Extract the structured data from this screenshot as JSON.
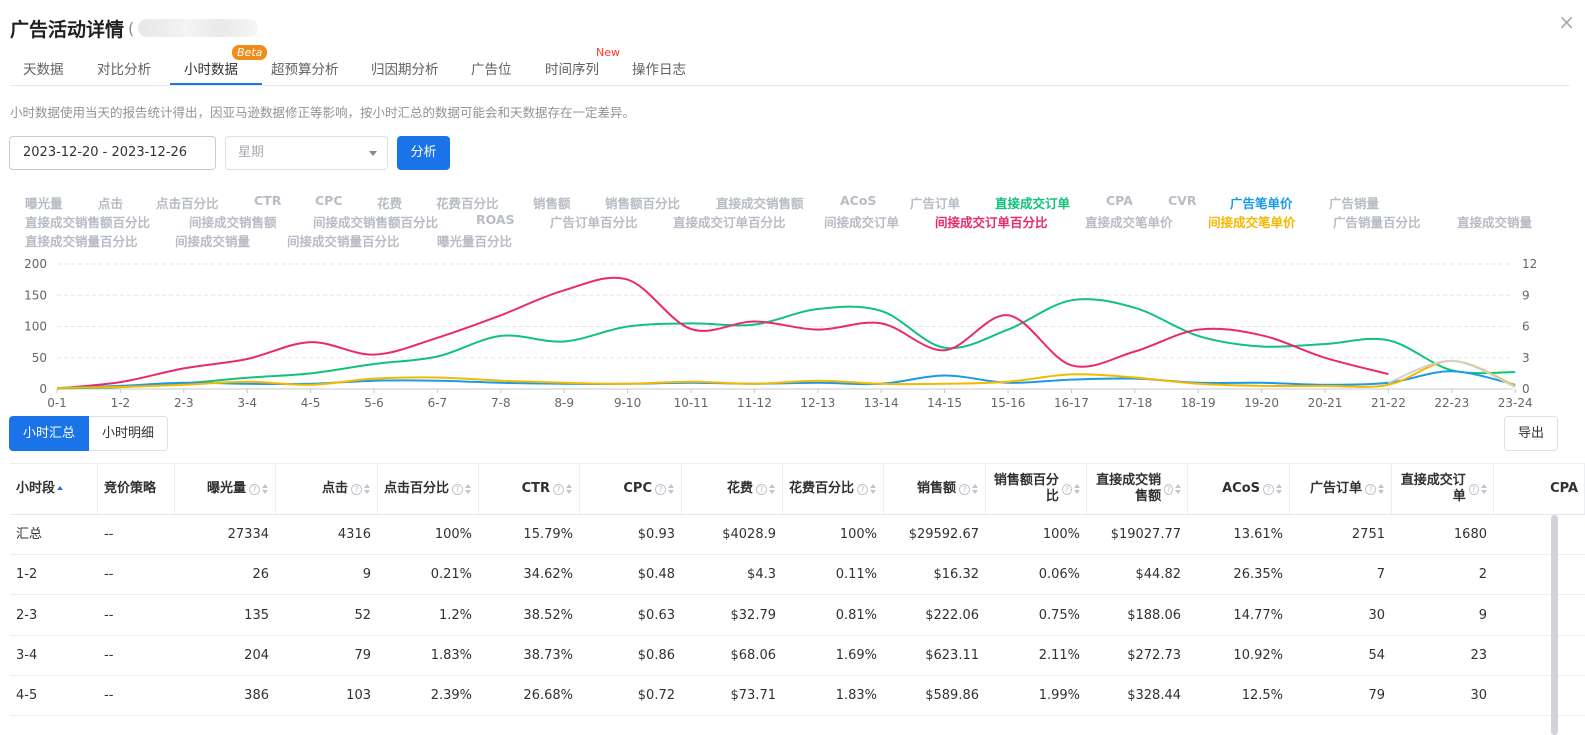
{
  "header": {
    "title": "广告活动详情",
    "paren": "(",
    "close": "×"
  },
  "tabs": [
    {
      "label": "天数据"
    },
    {
      "label": "对比分析"
    },
    {
      "label": "小时数据",
      "active": true,
      "badge": "Beta"
    },
    {
      "label": "超预算分析"
    },
    {
      "label": "归因期分析"
    },
    {
      "label": "广告位"
    },
    {
      "label": "时间序列",
      "badge": "New"
    },
    {
      "label": "操作日志"
    }
  ],
  "note": "小时数据使用当天的报告统计得出，因亚马逊数据修正等影响，按小时汇总的数据可能会和天数据存在一定差异。",
  "filters": {
    "date_range": "2023-12-20 - 2023-12-26",
    "week_placeholder": "星期",
    "analyze_label": "分析"
  },
  "metrics": [
    {
      "label": "曝光量"
    },
    {
      "label": "点击"
    },
    {
      "label": "点击百分比"
    },
    {
      "label": "CTR"
    },
    {
      "label": "CPC"
    },
    {
      "label": "花费"
    },
    {
      "label": "花费百分比"
    },
    {
      "label": "销售额"
    },
    {
      "label": "销售额百分比"
    },
    {
      "label": "直接成交销售额"
    },
    {
      "label": "ACoS"
    },
    {
      "label": "广告订单"
    },
    {
      "label": "直接成交订单",
      "color": "#10c27a"
    },
    {
      "label": "CPA"
    },
    {
      "label": "CVR"
    },
    {
      "label": "广告笔单价",
      "color": "#1a9be8"
    },
    {
      "label": "广告销量"
    },
    {
      "label": "直接成交销售额百分比"
    },
    {
      "label": "间接成交销售额"
    },
    {
      "label": "间接成交销售额百分比"
    },
    {
      "label": "ROAS"
    },
    {
      "label": "广告订单百分比"
    },
    {
      "label": "直接成交订单百分比"
    },
    {
      "label": "间接成交订单"
    },
    {
      "label": "间接成交订单百分比",
      "color": "#ea2a6a"
    },
    {
      "label": "直接成交笔单价"
    },
    {
      "label": "间接成交笔单价",
      "color": "#f5b800"
    },
    {
      "label": "广告销量百分比"
    },
    {
      "label": "直接成交销量"
    },
    {
      "label": "直接成交销量百分比"
    },
    {
      "label": "间接成交销量"
    },
    {
      "label": "间接成交销量百分比"
    },
    {
      "label": "曝光量百分比"
    }
  ],
  "chart_data": {
    "type": "line",
    "categories": [
      "0-1",
      "1-2",
      "2-3",
      "3-4",
      "4-5",
      "5-6",
      "6-7",
      "7-8",
      "8-9",
      "9-10",
      "10-11",
      "11-12",
      "12-13",
      "13-14",
      "14-15",
      "15-16",
      "16-17",
      "17-18",
      "18-19",
      "19-20",
      "20-21",
      "21-22",
      "22-23",
      "23-24"
    ],
    "y_left": {
      "ticks": [
        "0",
        "50",
        "100",
        "150",
        "200"
      ],
      "range": [
        0,
        200
      ]
    },
    "y_right": {
      "ticks": [
        "0",
        "3",
        "6",
        "9",
        "12"
      ],
      "range": [
        0,
        12
      ]
    },
    "grid": true,
    "series": [
      {
        "name": "直接成交订单",
        "color": "#10c27a",
        "axis": "left",
        "values": [
          1,
          3,
          9,
          18,
          25,
          40,
          52,
          85,
          76,
          100,
          105,
          103,
          128,
          125,
          66,
          95,
          142,
          130,
          85,
          68,
          72,
          78,
          30,
          27
        ]
      },
      {
        "name": "间接成交订单百分比",
        "color": "#ea2a6a",
        "axis": "left",
        "values": [
          1,
          11,
          33,
          48,
          75,
          55,
          82,
          118,
          158,
          175,
          96,
          108,
          95,
          105,
          62,
          118,
          38,
          60,
          95,
          86,
          50,
          24
        ]
      },
      {
        "name": "广告笔单价",
        "color": "#1a9be8",
        "axis": "right",
        "values": [
          0.1,
          0.3,
          0.6,
          0.5,
          0.5,
          0.8,
          0.8,
          0.6,
          0.5,
          0.5,
          0.6,
          0.5,
          0.6,
          0.5,
          1.3,
          0.6,
          0.9,
          1.0,
          0.6,
          0.6,
          0.4,
          0.6,
          1.7,
          0.4
        ]
      },
      {
        "name": "间接成交笔单价",
        "color": "#f5b800",
        "axis": "right",
        "values": [
          0.1,
          0.2,
          0.4,
          0.7,
          0.4,
          1.0,
          1.1,
          0.8,
          0.6,
          0.5,
          0.7,
          0.5,
          0.8,
          0.5,
          0.5,
          0.7,
          1.4,
          1.1,
          0.5,
          0.3,
          0.3,
          0.4,
          2.7,
          0.3
        ]
      },
      {
        "name": "",
        "color": "#d0d0d0",
        "axis": "right",
        "values": [
          null,
          null,
          null,
          null,
          null,
          null,
          null,
          null,
          null,
          null,
          null,
          null,
          null,
          null,
          null,
          null,
          null,
          null,
          null,
          null,
          null,
          0.6,
          2.7,
          0.2
        ]
      }
    ]
  },
  "view_toggle": {
    "summary": "小时汇总",
    "detail": "小时明细"
  },
  "export_label": "导出",
  "table": {
    "columns": [
      {
        "label": "小时段",
        "sort": "asc"
      },
      {
        "label": "竞价策略"
      },
      {
        "label": "曝光量",
        "hint": true,
        "sort": "both"
      },
      {
        "label": "点击",
        "hint": true,
        "sort": "both"
      },
      {
        "label": "点击百分比",
        "hint": true,
        "sort": "both"
      },
      {
        "label": "CTR",
        "hint": true,
        "sort": "both"
      },
      {
        "label": "CPC",
        "hint": true,
        "sort": "both"
      },
      {
        "label": "花费",
        "hint": true,
        "sort": "both"
      },
      {
        "label": "花费百分比",
        "hint": true,
        "sort": "both"
      },
      {
        "label": "销售额",
        "hint": true,
        "sort": "both"
      },
      {
        "label": "销售额百分比",
        "hint": true,
        "sort": "both"
      },
      {
        "label": "直接成交销售额",
        "hint": true,
        "sort": "both"
      },
      {
        "label": "ACoS",
        "hint": true,
        "sort": "both"
      },
      {
        "label": "广告订单",
        "hint": true,
        "sort": "both"
      },
      {
        "label": "直接成交订单",
        "hint": true,
        "sort": "both"
      },
      {
        "label": "CPA"
      }
    ],
    "rows": [
      [
        "汇总",
        "--",
        "27334",
        "4316",
        "100%",
        "15.79%",
        "$0.93",
        "$4028.9",
        "100%",
        "$29592.67",
        "100%",
        "$19027.77",
        "13.61%",
        "2751",
        "1680",
        ""
      ],
      [
        "1-2",
        "--",
        "26",
        "9",
        "0.21%",
        "34.62%",
        "$0.48",
        "$4.3",
        "0.11%",
        "$16.32",
        "0.06%",
        "$44.82",
        "26.35%",
        "7",
        "2",
        ""
      ],
      [
        "2-3",
        "--",
        "135",
        "52",
        "1.2%",
        "38.52%",
        "$0.63",
        "$32.79",
        "0.81%",
        "$222.06",
        "0.75%",
        "$188.06",
        "14.77%",
        "30",
        "9",
        ""
      ],
      [
        "3-4",
        "--",
        "204",
        "79",
        "1.83%",
        "38.73%",
        "$0.86",
        "$68.06",
        "1.69%",
        "$623.11",
        "2.11%",
        "$272.73",
        "10.92%",
        "54",
        "23",
        ""
      ],
      [
        "4-5",
        "--",
        "386",
        "103",
        "2.39%",
        "26.68%",
        "$0.72",
        "$73.71",
        "1.83%",
        "$589.86",
        "1.99%",
        "$328.44",
        "12.5%",
        "79",
        "30",
        ""
      ]
    ]
  }
}
